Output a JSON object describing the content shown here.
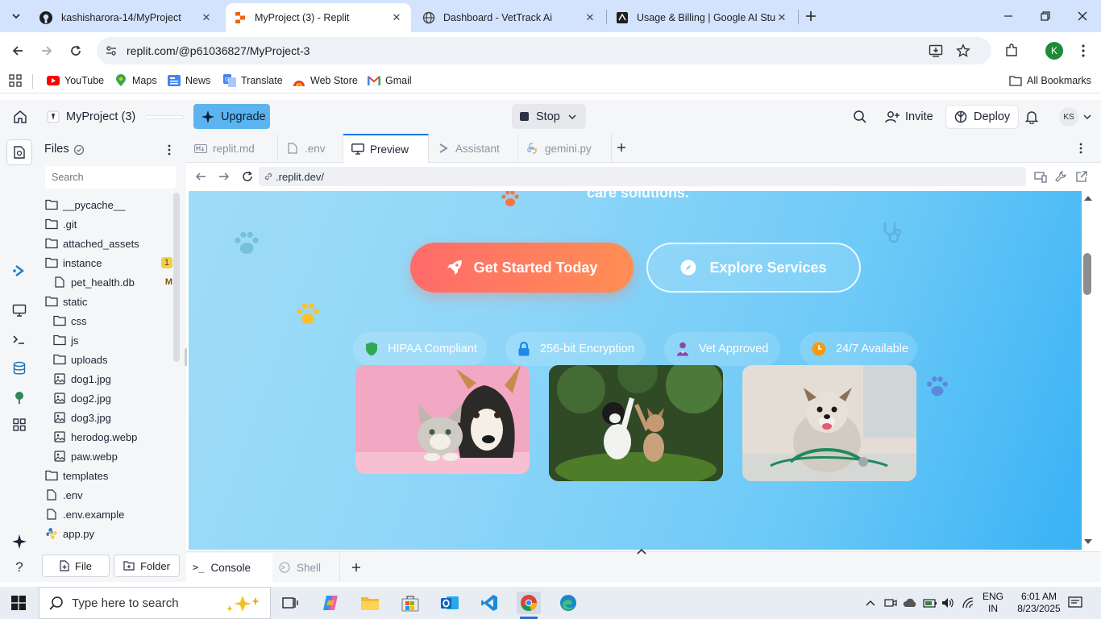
{
  "browser": {
    "tabs": [
      {
        "title": "kashisharora-14/MyProject",
        "icon": "github-icon",
        "active": false
      },
      {
        "title": "MyProject (3) - Replit",
        "icon": "replit-icon",
        "active": true
      },
      {
        "title": "Dashboard - VetTrack Ai",
        "icon": "globe-icon",
        "active": false
      },
      {
        "title": "Usage & Billing | Google AI Stud",
        "icon": "google-ai-studio-icon",
        "active": false
      }
    ],
    "url": "replit.com/@p61036827/MyProject-3",
    "profile_initial": "K",
    "bookmarks": [
      {
        "label": "YouTube",
        "icon": "youtube-icon"
      },
      {
        "label": "Maps",
        "icon": "maps-icon"
      },
      {
        "label": "News",
        "icon": "news-icon"
      },
      {
        "label": "Translate",
        "icon": "translate-icon"
      },
      {
        "label": "Web Store",
        "icon": "webstore-icon"
      },
      {
        "label": "Gmail",
        "icon": "gmail-icon"
      }
    ],
    "all_bookmarks": "All Bookmarks"
  },
  "replit": {
    "project_name": "MyProject (3)",
    "upgrade": "Upgrade",
    "stop": "Stop",
    "invite": "Invite",
    "deploy": "Deploy",
    "avatar_initials": "KS",
    "files_title": "Files",
    "search_placeholder": "Search",
    "files": [
      {
        "name": "__pycache__",
        "type": "folder",
        "indent": 0
      },
      {
        "name": ".git",
        "type": "folder",
        "indent": 0
      },
      {
        "name": "attached_assets",
        "type": "folder",
        "indent": 0
      },
      {
        "name": "instance",
        "type": "folder",
        "indent": 0,
        "badge": "1"
      },
      {
        "name": "pet_health.db",
        "type": "file",
        "indent": 1,
        "badge": "M"
      },
      {
        "name": "static",
        "type": "folder",
        "indent": 0
      },
      {
        "name": "css",
        "type": "folder",
        "indent": 1
      },
      {
        "name": "js",
        "type": "folder",
        "indent": 1
      },
      {
        "name": "uploads",
        "type": "folder",
        "indent": 1
      },
      {
        "name": "dog1.jpg",
        "type": "image",
        "indent": 1
      },
      {
        "name": "dog2.jpg",
        "type": "image",
        "indent": 1
      },
      {
        "name": "dog3.jpg",
        "type": "image",
        "indent": 1
      },
      {
        "name": "herodog.webp",
        "type": "image",
        "indent": 1
      },
      {
        "name": "paw.webp",
        "type": "image",
        "indent": 1
      },
      {
        "name": "templates",
        "type": "folder",
        "indent": 0
      },
      {
        "name": ".env",
        "type": "file",
        "indent": 0
      },
      {
        "name": ".env.example",
        "type": "file",
        "indent": 0
      },
      {
        "name": "app.py",
        "type": "python",
        "indent": 0
      }
    ],
    "new_file": "File",
    "new_folder": "Folder",
    "editor_tabs": [
      {
        "label": "replit.md",
        "icon": "markdown-icon",
        "active": false
      },
      {
        "label": ".env",
        "icon": "file-icon",
        "active": false
      },
      {
        "label": "Preview",
        "icon": "monitor-icon",
        "active": true
      },
      {
        "label": "Assistant",
        "icon": "assistant-icon",
        "active": false
      },
      {
        "label": "gemini.py",
        "icon": "python-icon",
        "active": false
      }
    ],
    "preview_url": ".replit.dev/",
    "console_tabs": [
      {
        "label": "Console",
        "active": true
      },
      {
        "label": "Shell",
        "active": false
      }
    ]
  },
  "site": {
    "tagline_partial": "care solutions.",
    "cta_primary": "Get Started Today",
    "cta_secondary": "Explore Services",
    "badges": [
      {
        "label": "HIPAA Compliant",
        "icon": "shield-icon",
        "color": "#2fa84f"
      },
      {
        "label": "256-bit Encryption",
        "icon": "lock-icon",
        "color": "#1e88e5"
      },
      {
        "label": "Vet Approved",
        "icon": "doctor-icon",
        "color": "#8e44ad"
      },
      {
        "label": "24/7 Available",
        "icon": "clock-icon",
        "color": "#f39c12"
      }
    ],
    "images": [
      "cat-and-dog-photo",
      "puppy-and-kitten-photo",
      "terrier-with-stethoscope-photo"
    ]
  },
  "taskbar": {
    "search_placeholder": "Type here to search",
    "language": "ENG",
    "region": "IN",
    "time": "6:01 AM",
    "date": "8/23/2025"
  },
  "colors": {
    "chrome_tabstrip": "#d3e3fd",
    "replit_upgrade": "#5bb4f0",
    "cta_primary_start": "#ff6b6b",
    "cta_primary_end": "#ff8e53",
    "preview_bg_start": "#9fdcf7",
    "preview_bg_end": "#39b2f5"
  }
}
